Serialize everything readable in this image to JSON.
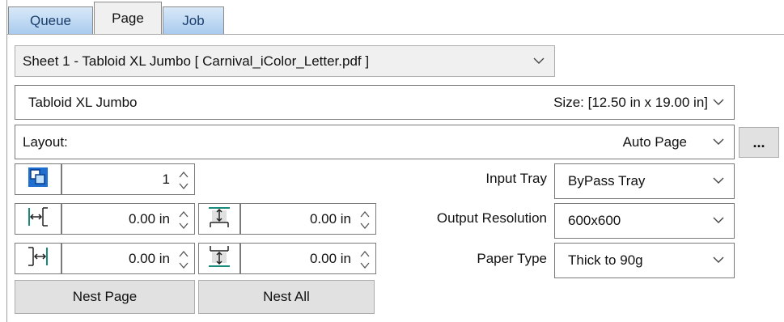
{
  "tabs": [
    {
      "label": "Queue",
      "active": false
    },
    {
      "label": "Page",
      "active": true
    },
    {
      "label": "Job",
      "active": false
    }
  ],
  "sheet_select": {
    "value": "Sheet 1 - Tabloid XL Jumbo [ Carnival_iColor_Letter.pdf ]"
  },
  "media_select": {
    "name": "Tabloid XL Jumbo",
    "size": "Size: [12.50 in x 19.00 in]"
  },
  "layout_select": {
    "label": "Layout:",
    "value": "Auto Page"
  },
  "layout_more_button": "...",
  "copies": {
    "value": "1"
  },
  "margins": {
    "left": "0.00 in",
    "right": "0.00 in",
    "top": "0.00 in",
    "bottom": "0.00 in"
  },
  "input_tray": {
    "label": "Input Tray",
    "value": "ByPass Tray"
  },
  "output_resolution": {
    "label": "Output Resolution",
    "value": "600x600"
  },
  "paper_type": {
    "label": "Paper Type",
    "value": "Thick to 90g"
  },
  "buttons": {
    "nest_page": "Nest Page",
    "nest_all": "Nest All"
  },
  "colors": {
    "tab_blue": "#a9cbee",
    "icon_blue": "#1f6fd0",
    "icon_teal": "#1a8a7a"
  },
  "icons": [
    "copies-icon",
    "left-margin-icon",
    "right-margin-icon",
    "top-margin-icon",
    "bottom-margin-icon",
    "chevron-down-icon",
    "spinner-icon"
  ]
}
